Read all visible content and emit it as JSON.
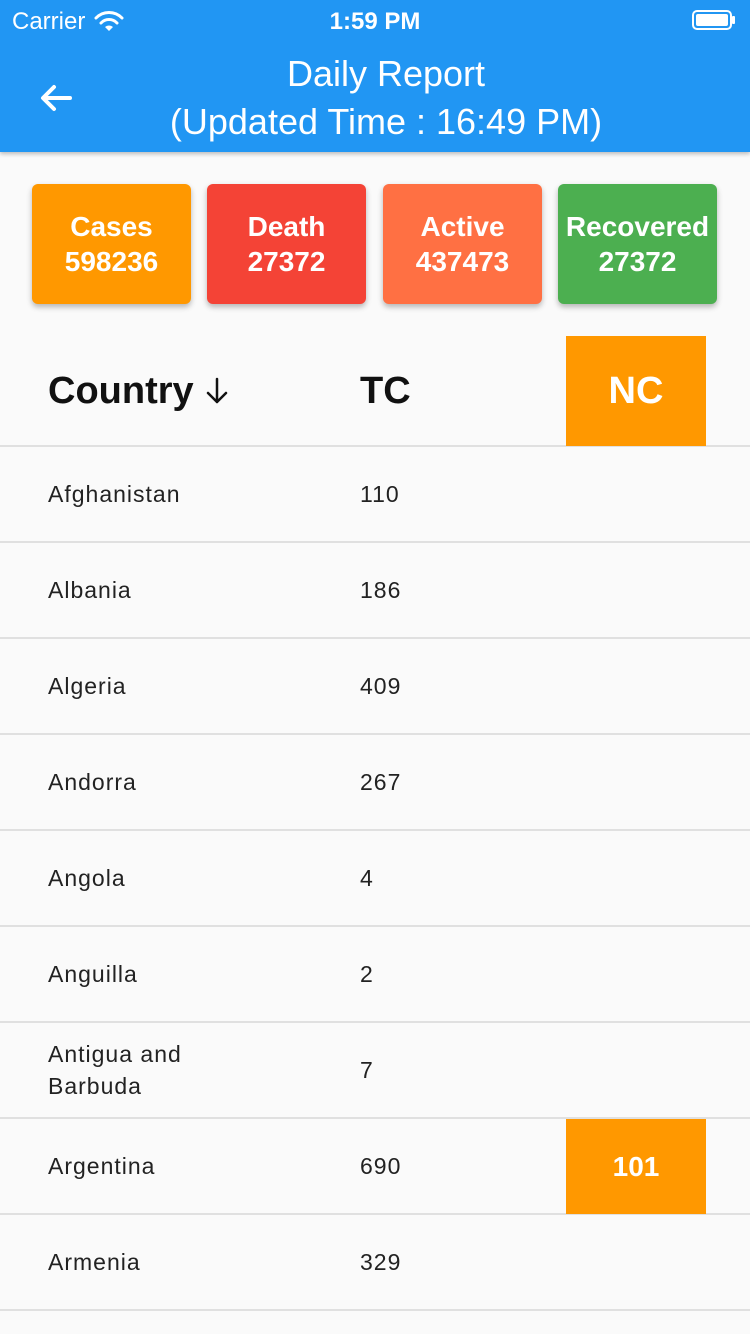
{
  "status_bar": {
    "carrier": "Carrier",
    "time": "1:59 PM"
  },
  "header": {
    "title_line1": "Daily Report",
    "title_line2": "(Updated Time : 16:49 PM)",
    "color": "#2196f3"
  },
  "summary": [
    {
      "label": "Cases",
      "value": "598236",
      "color": "#ff9800"
    },
    {
      "label": "Death",
      "value": "27372",
      "color": "#f44336"
    },
    {
      "label": "Active",
      "value": "437473",
      "color": "#ff7043"
    },
    {
      "label": "Recovered",
      "value": "27372",
      "color": "#4caf50"
    }
  ],
  "table": {
    "headers": {
      "country": "Country",
      "tc": "TC",
      "nc": "NC"
    },
    "highlight_color": "#ff9800",
    "rows": [
      {
        "country": "Afghanistan",
        "tc": "110",
        "nc": ""
      },
      {
        "country": "Albania",
        "tc": "186",
        "nc": ""
      },
      {
        "country": "Algeria",
        "tc": "409",
        "nc": ""
      },
      {
        "country": "Andorra",
        "tc": "267",
        "nc": ""
      },
      {
        "country": "Angola",
        "tc": "4",
        "nc": ""
      },
      {
        "country": "Anguilla",
        "tc": "2",
        "nc": ""
      },
      {
        "country": "Antigua and Barbuda",
        "tc": "7",
        "nc": ""
      },
      {
        "country": "Argentina",
        "tc": "690",
        "nc": "101"
      },
      {
        "country": "Armenia",
        "tc": "329",
        "nc": ""
      }
    ]
  }
}
